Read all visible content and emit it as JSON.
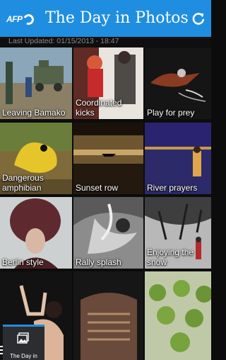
{
  "header": {
    "logo_text": "AFP",
    "title": "The Day in Photos",
    "refresh_icon": "refresh-icon",
    "accent": "#1f8ee0"
  },
  "status": {
    "last_updated": "Last Updated: 01/15/2013 - 18:47"
  },
  "photos": [
    {
      "caption": "Leaving Bamako"
    },
    {
      "caption": "Coordinated kicks"
    },
    {
      "caption": "Play for prey"
    },
    {
      "caption": "Dangerous amphibian"
    },
    {
      "caption": "Sunset row"
    },
    {
      "caption": "River prayers"
    },
    {
      "caption": "Berlin style"
    },
    {
      "caption": "Rally splash"
    },
    {
      "caption": "Enjoying the snow"
    },
    {
      "caption": ""
    },
    {
      "caption": ""
    },
    {
      "caption": ""
    }
  ],
  "bottom_tab": {
    "label": "The Day in",
    "icon": "photos-icon"
  }
}
